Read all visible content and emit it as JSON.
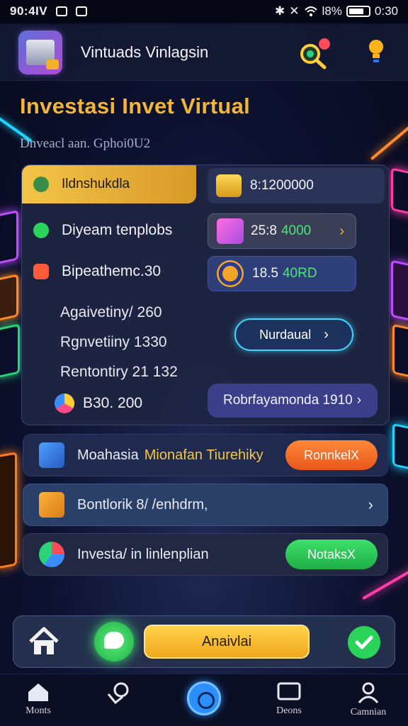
{
  "status_bar": {
    "time_left": "90:4IV",
    "battery": "l8%",
    "time_right": "0:30"
  },
  "header": {
    "title": "Vintuads Vinlagsin"
  },
  "page": {
    "title": "Investasi Invet Virtual",
    "subtitle": "Dnveacl aan. Gphoi0U2"
  },
  "panel": {
    "tab_label": "Ildnshukdla",
    "rows": [
      {
        "label": "Diyeam tenplobs"
      },
      {
        "label": "Bipeathemc.30"
      }
    ],
    "plain_rows": [
      "Agaivetiny/ 260",
      "Rgnvetiiny 1330",
      "Rentontiry 21 132"
    ],
    "badge_value": "B30. 200",
    "stats": [
      {
        "value": "8:1200000"
      },
      {
        "value": "25:8",
        "value_green": "4000"
      },
      {
        "value": "18.5",
        "value_green": "40RD"
      }
    ],
    "outline_button": "Nurdaual",
    "wide_button": "Robrfayamonda 1910"
  },
  "rows": [
    {
      "label": "Moahasia",
      "highlight": "Mionafan Tiurehiky",
      "button": "RonnkelX"
    },
    {
      "label": "Bontlorik 8/ /enhdrm,"
    },
    {
      "label": "Investa/ in linlenplian",
      "button": "NotaksX"
    }
  ],
  "action_bar": {
    "main_button": "Anaivlai"
  },
  "bottom_nav": [
    {
      "label": "Monts"
    },
    {
      "label": ""
    },
    {
      "label": ""
    },
    {
      "label": "Deons"
    },
    {
      "label": "Camnian"
    }
  ],
  "colors": {
    "accent_gold": "#f2b53a",
    "accent_green": "#2ad35a",
    "accent_orange": "#e8561a",
    "accent_cyan": "#3fd6ff",
    "background": "#0d1230"
  },
  "icons": [
    "home-icon",
    "chat-icon",
    "check-icon",
    "search-icon",
    "bulb-icon",
    "coin-icon",
    "gift-icon",
    "gauge-icon"
  ]
}
